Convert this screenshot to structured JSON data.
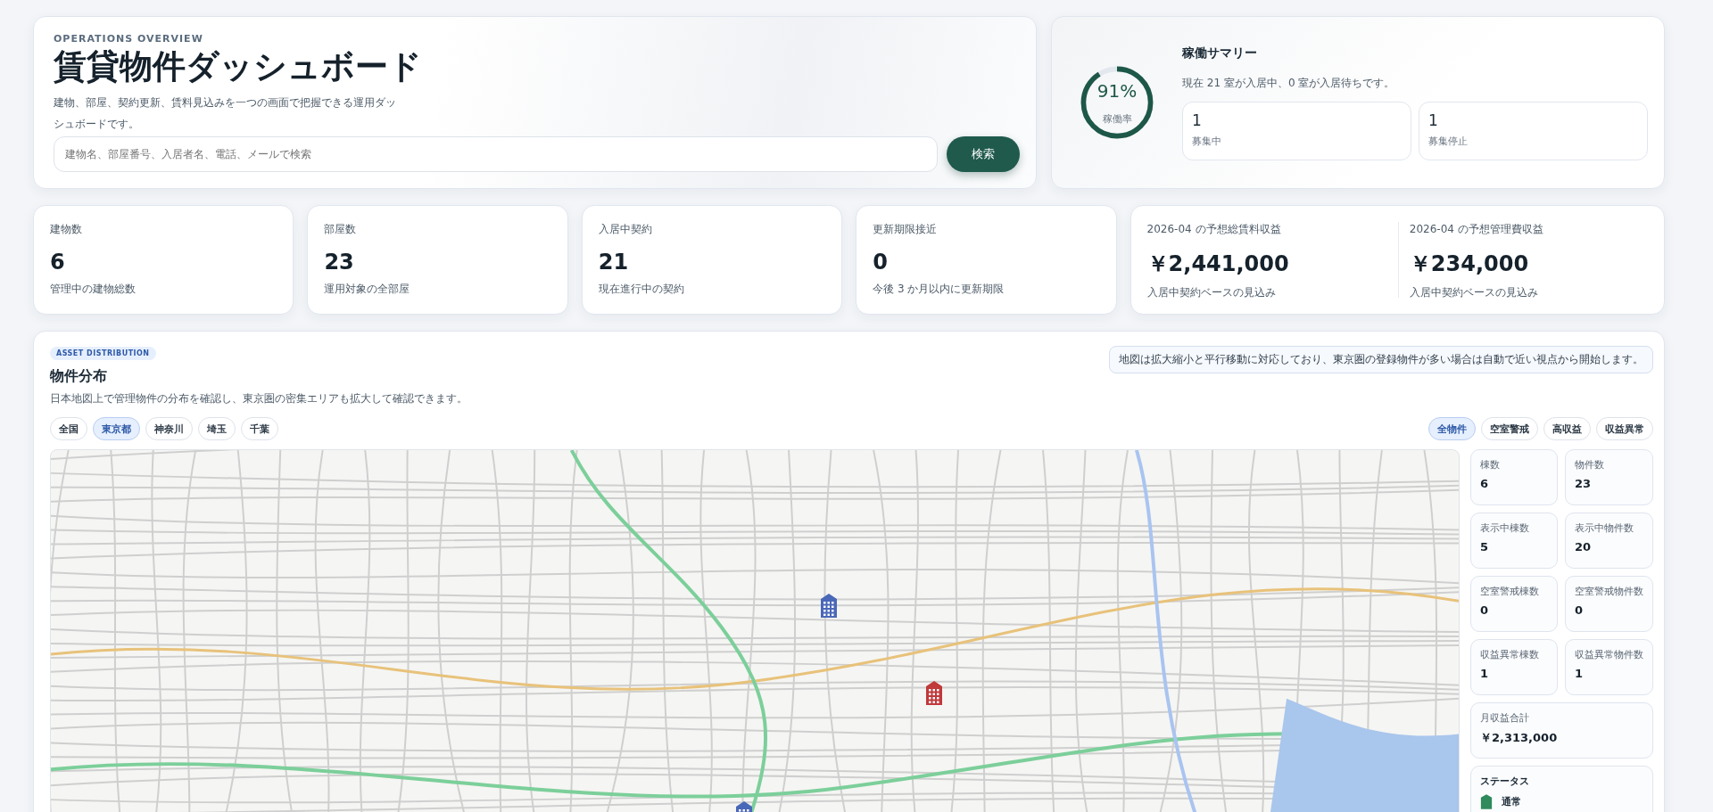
{
  "header": {
    "eyebrow": "OPERATIONS OVERVIEW",
    "title": "賃貸物件ダッシュボード",
    "description": "建物、部屋、契約更新、賃料見込みを一つの画面で把握できる運用ダッシュボードです。",
    "search": {
      "placeholder": "建物名、部屋番号、入居者名、電話、メールで検索"
    },
    "search_button": "検索"
  },
  "summary": {
    "gauge": {
      "value": "91%",
      "label": "稼働率",
      "level": 0.91
    },
    "title": "稼働サマリー",
    "text": "現在 21 室が入居中、0 室が入居待ちです。",
    "tiles": [
      {
        "value": "1",
        "label": "募集中"
      },
      {
        "value": "1",
        "label": "募集停止"
      }
    ]
  },
  "stats": [
    {
      "label": "建物数",
      "value": "6",
      "note": "管理中の建物総数"
    },
    {
      "label": "部屋数",
      "value": "23",
      "note": "運用対象の全部屋"
    },
    {
      "label": "入居中契約",
      "value": "21",
      "note": "現在進行中の契約"
    },
    {
      "label": "更新期限接近",
      "value": "0",
      "note": "今後 3 か月以内に更新期限"
    }
  ],
  "revenue": [
    {
      "label": "2026-04 の予想総賃料収益",
      "value": "￥2,441,000",
      "note": "入居中契約ベースの見込み"
    },
    {
      "label": "2026-04 の予想管理費収益",
      "value": "￥234,000",
      "note": "入居中契約ベースの見込み"
    }
  ],
  "map_section": {
    "badge": "ASSET DISTRIBUTION",
    "title": "物件分布",
    "description": "日本地図上で管理物件の分布を確認し、東京圏の密集エリアも拡大して確認できます。",
    "notice": "地図は拡大縮小と平行移動に対応しており、東京圏の登録物件が多い場合は自動で近い視点から開始します。",
    "region_chips": [
      {
        "label": "全国",
        "selected": false
      },
      {
        "label": "東京都",
        "selected": true
      },
      {
        "label": "神奈川",
        "selected": false
      },
      {
        "label": "埼玉",
        "selected": false
      },
      {
        "label": "千葉",
        "selected": false
      }
    ],
    "filter_chips": [
      {
        "label": "全物件",
        "selected": true
      },
      {
        "label": "空室警戒",
        "selected": false
      },
      {
        "label": "高収益",
        "selected": false
      },
      {
        "label": "収益異常",
        "selected": false
      }
    ],
    "side_stats": [
      {
        "label": "棟数",
        "value": "6"
      },
      {
        "label": "物件数",
        "value": "23"
      },
      {
        "label": "表示中棟数",
        "value": "5"
      },
      {
        "label": "表示中物件数",
        "value": "20"
      },
      {
        "label": "空室警戒棟数",
        "value": "0"
      },
      {
        "label": "空室警戒物件数",
        "value": "0"
      },
      {
        "label": "収益異常棟数",
        "value": "1"
      },
      {
        "label": "収益異常物件数",
        "value": "1"
      }
    ],
    "total": {
      "label": "月収益合計",
      "value": "￥2,313,000"
    },
    "status_legend": {
      "title": "ステータス",
      "items": [
        {
          "label": "通常",
          "color": "#2f8a5c"
        }
      ]
    }
  }
}
